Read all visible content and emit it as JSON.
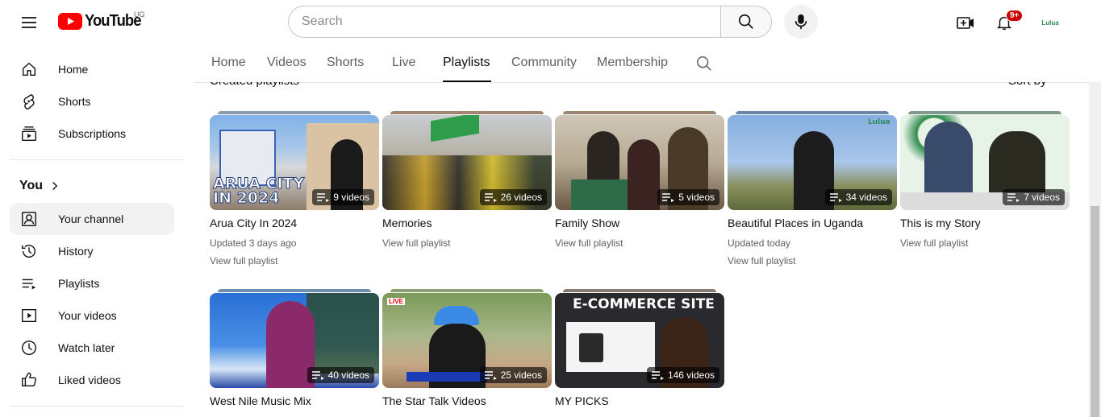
{
  "header": {
    "logo_text": "YouTube",
    "country_code": "UG",
    "search_placeholder": "Search",
    "notification_count": "9+",
    "avatar_text": "Lulua"
  },
  "sidebar": {
    "top_items": [
      {
        "label": "Home",
        "icon": "home-icon"
      },
      {
        "label": "Shorts",
        "icon": "shorts-icon"
      },
      {
        "label": "Subscriptions",
        "icon": "subscriptions-icon"
      }
    ],
    "you_heading": "You",
    "you_items": [
      {
        "label": "Your channel",
        "icon": "your-channel-icon",
        "active": true
      },
      {
        "label": "History",
        "icon": "history-icon"
      },
      {
        "label": "Playlists",
        "icon": "playlists-icon"
      },
      {
        "label": "Your videos",
        "icon": "your-videos-icon"
      },
      {
        "label": "Watch later",
        "icon": "watch-later-icon"
      },
      {
        "label": "Liked videos",
        "icon": "liked-videos-icon"
      }
    ]
  },
  "tabs": {
    "items": [
      "Home",
      "Videos",
      "Shorts",
      "Live",
      "Playlists",
      "Community",
      "Membership"
    ],
    "active": "Playlists"
  },
  "section": {
    "heading": "Created playlists",
    "sort_label": "Sort by"
  },
  "playlists": [
    {
      "title": "Arua City In 2024",
      "count": "9 videos",
      "meta": "Updated 3 days ago",
      "link": "View full playlist",
      "thumb_text": "ARUA CITY IN 2024"
    },
    {
      "title": "Memories",
      "count": "26 videos",
      "meta": "",
      "link": "View full playlist"
    },
    {
      "title": "Family Show",
      "count": "5 videos",
      "meta": "",
      "link": "View full playlist"
    },
    {
      "title": "Beautiful Places in Uganda",
      "count": "34 videos",
      "meta": "Updated today",
      "link": "View full playlist",
      "thumb_text": "Lulua"
    },
    {
      "title": "This is my Story",
      "count": "7 videos",
      "meta": "",
      "link": "View full playlist"
    },
    {
      "title": "West Nile Music Mix",
      "count": "40 videos",
      "meta": "",
      "link": ""
    },
    {
      "title": "The Star Talk Videos",
      "count": "25 videos",
      "meta": "",
      "link": "",
      "thumb_text": "LIVE"
    },
    {
      "title": "MY PICKS",
      "count": "146 videos",
      "meta": "",
      "link": "",
      "thumb_text": "E-COMMERCE SITE"
    }
  ],
  "colors": {
    "brand_red": "#ff0000",
    "badge_red": "#cc0000",
    "text_primary": "#0f0f0f",
    "text_secondary": "#606060"
  }
}
